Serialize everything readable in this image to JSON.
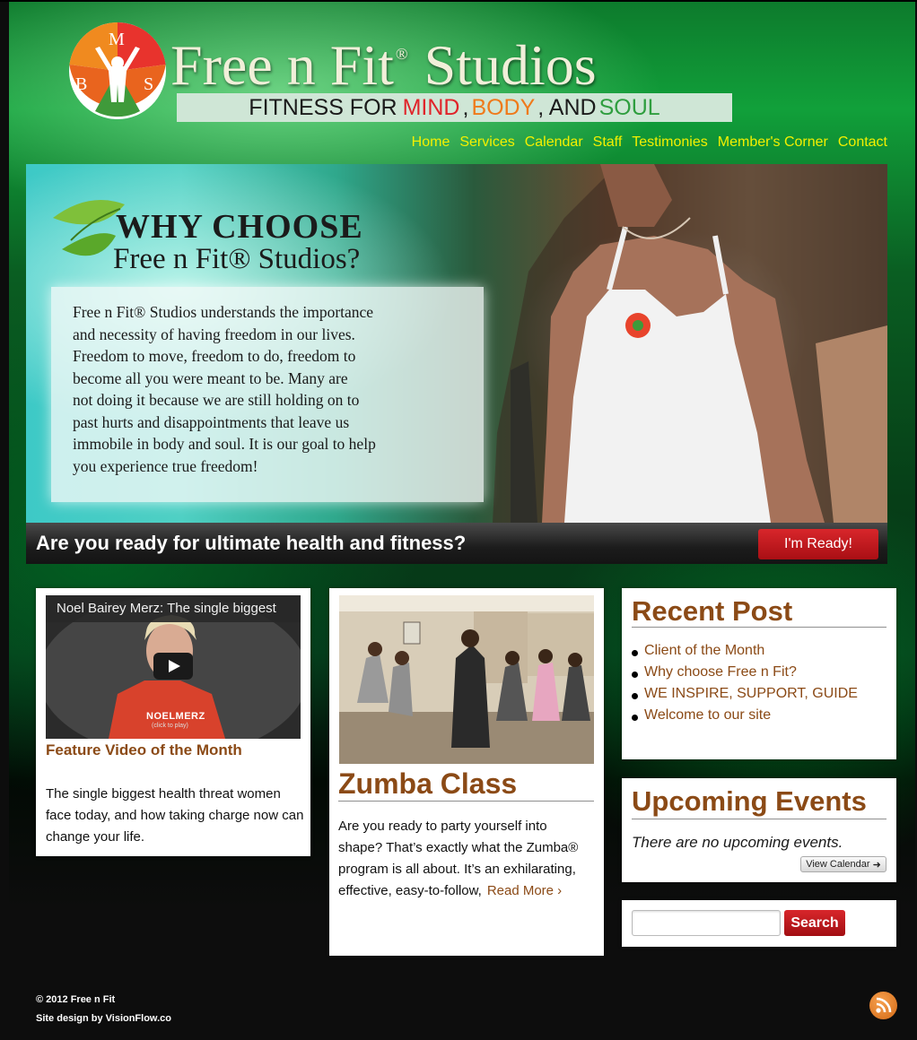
{
  "brand": {
    "logo_letters": [
      "M",
      "B",
      "S"
    ],
    "name_part1": "Free n Fit",
    "registered": "®",
    "name_part2": "Studios",
    "tagline": {
      "prefix": "FITNESS FOR",
      "mind": "MIND",
      "sep1": ",",
      "body": "BODY",
      "sep2": ", AND",
      "soul": "SOUL"
    }
  },
  "nav": {
    "items": [
      "Home",
      "Services",
      "Calendar",
      "Staff",
      "Testimonies",
      "Member's Corner",
      "Contact"
    ]
  },
  "hero": {
    "title_line1": "WHY CHOOSE",
    "title_line2": "Free n Fit® Studios?",
    "body_lines": [
      "Free n Fit® Studios understands the importance",
      "and necessity of having freedom in our lives.",
      "Freedom to move, freedom to do, freedom to",
      "become all you were meant to be.  Many are",
      "not doing it because we are still holding on to",
      "past hurts and disappointments that leave us",
      "immobile in body and soul.  It is our goal to help",
      "you experience true freedom!"
    ],
    "cta_question": "Are you ready for ultimate health and fitness?",
    "cta_button": "I'm Ready!"
  },
  "feature_video": {
    "video_title": "Noel Bairey Merz: The single biggest",
    "watermark_name": "NOELMERZ",
    "watermark_hint": "(click to play)",
    "heading": "Feature Video of the Month",
    "text": "The single biggest health threat women face today, and how taking charge now can change your life."
  },
  "zumba": {
    "heading": "Zumba Class",
    "text": "Are you ready to party yourself into shape? That’s exactly what the Zumba® program is all about. It’s an exhilarating, effective, easy-to-follow,",
    "read_more": "Read More ›"
  },
  "recent_post": {
    "heading": "Recent Post",
    "items": [
      "Client of the Month",
      "Why choose Free n Fit?",
      "WE INSPIRE, SUPPORT, GUIDE",
      "Welcome to our site"
    ]
  },
  "events": {
    "heading": "Upcoming Events",
    "empty_text": "There are no upcoming events.",
    "view_calendar": "View Calendar",
    "arrow": "➜"
  },
  "search": {
    "value": "",
    "button": "Search"
  },
  "footer": {
    "copyright": "© 2012 Free n Fit",
    "credit": "Site design by VisionFlow.co"
  },
  "colors": {
    "accent_brown": "#8b4a16",
    "nav_yellow": "#f3f000",
    "button_red": "#c4181d",
    "mind_red": "#e0242a",
    "body_orange": "#ef7a1b",
    "soul_green": "#2f9e3f"
  }
}
